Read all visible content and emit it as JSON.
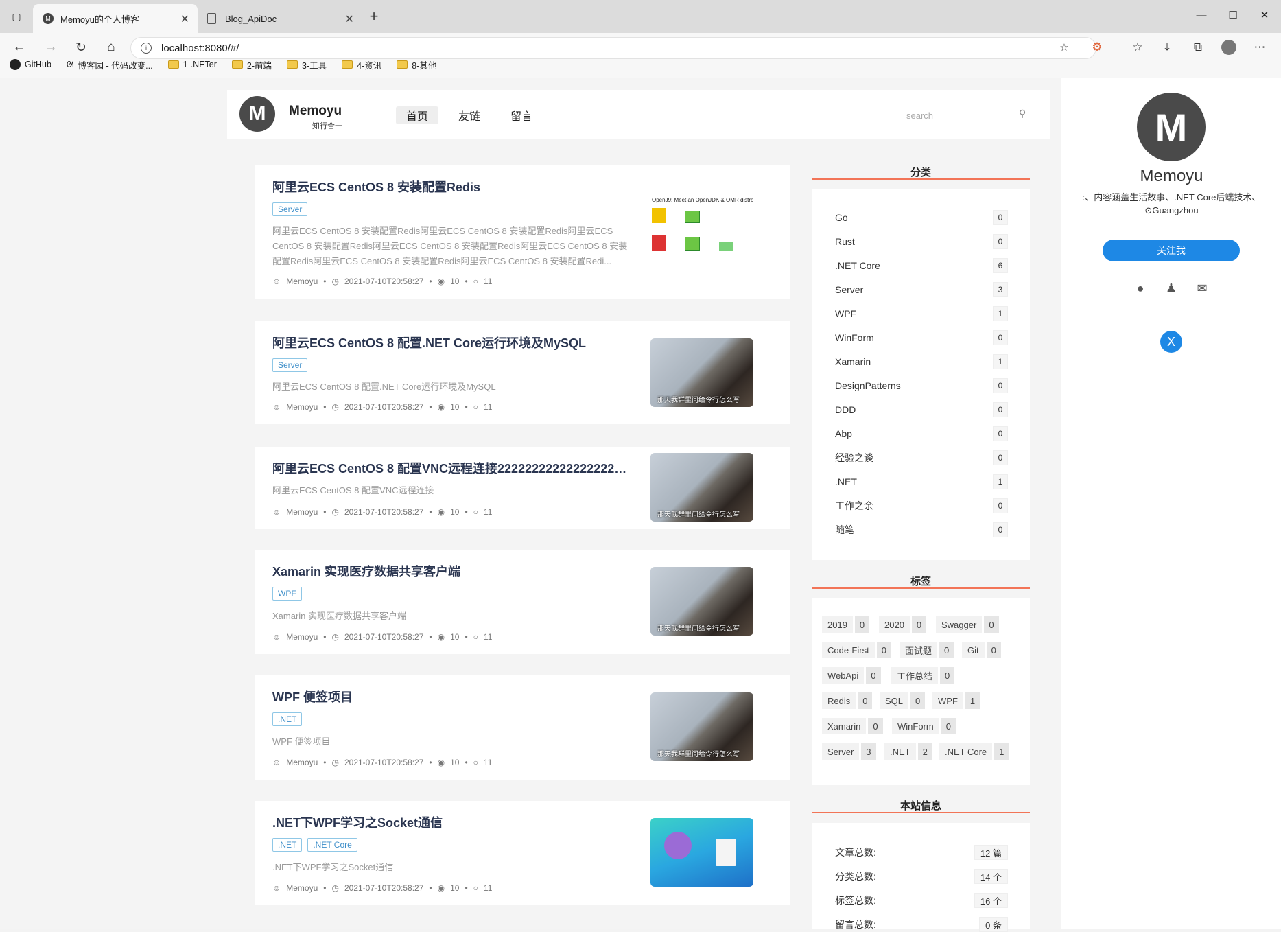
{
  "browser": {
    "tabs": [
      {
        "title": "Memoyu的个人博客",
        "active": true
      },
      {
        "title": "Blog_ApiDoc",
        "active": false
      }
    ],
    "url": "localhost:8080/#/",
    "bookmarks": [
      "GitHub",
      "博客园 - 代码改变...",
      "1-.NETer",
      "2-前端",
      "3-工具",
      "4-资讯",
      "8-其他"
    ]
  },
  "header": {
    "brand": "Memoyu",
    "subtitle": "知行合一",
    "nav": [
      "首页",
      "友链",
      "留言"
    ],
    "search_placeholder": "search"
  },
  "articles": [
    {
      "title": "阿里云ECS CentOS 8 安装配置Redis",
      "tags": [
        "Server"
      ],
      "summary": "阿里云ECS CentOS 8 安装配置Redis阿里云ECS CentOS 8 安装配置Redis阿里云ECS CentOS 8 安装配置Redis阿里云ECS CentOS 8 安装配置Redis阿里云ECS CentOS 8 安装配置Redis阿里云ECS CentOS 8 安装配置Redis阿里云ECS CentOS 8 安装配置Redi...",
      "author": "Memoyu",
      "date": "2021-07-10T20:58:27",
      "views": "10",
      "comments": "11"
    },
    {
      "title": "阿里云ECS CentOS 8 配置.NET Core运行环境及MySQL",
      "tags": [
        "Server"
      ],
      "summary": "阿里云ECS CentOS 8 配置.NET Core运行环境及MySQL",
      "author": "Memoyu",
      "date": "2021-07-10T20:58:27",
      "views": "10",
      "comments": "11",
      "caption": "那天我群里问给令行怎么写"
    },
    {
      "title": "阿里云ECS CentOS 8 配置VNC远程连接2222222222222222222...",
      "tags": [],
      "summary": "阿里云ECS CentOS 8 配置VNC远程连接",
      "author": "Memoyu",
      "date": "2021-07-10T20:58:27",
      "views": "10",
      "comments": "11",
      "caption": "那天我群里问给令行怎么写"
    },
    {
      "title": "Xamarin 实现医疗数据共享客户端",
      "tags": [
        "WPF"
      ],
      "summary": "Xamarin 实现医疗数据共享客户端",
      "author": "Memoyu",
      "date": "2021-07-10T20:58:27",
      "views": "10",
      "comments": "11",
      "caption": "那天我群里问给令行怎么写"
    },
    {
      "title": "WPF 便签项目",
      "tags": [
        ".NET"
      ],
      "summary": "WPF 便签项目",
      "author": "Memoyu",
      "date": "2021-07-10T20:58:27",
      "views": "10",
      "comments": "11",
      "caption": "那天我群里问给令行怎么写"
    },
    {
      "title": ".NET下WPF学习之Socket通信",
      "tags": [
        ".NET",
        ".NET Core"
      ],
      "summary": ".NET下WPF学习之Socket通信",
      "author": "Memoyu",
      "date": "2021-07-10T20:58:27",
      "views": "10",
      "comments": "11"
    }
  ],
  "diagram_thumb": {
    "title": "OpenJ9: Meet an OpenJDK & OMR distro"
  },
  "categories": {
    "title": "分类",
    "items": [
      {
        "name": "Go",
        "count": "0"
      },
      {
        "name": "Rust",
        "count": "0"
      },
      {
        "name": ".NET Core",
        "count": "6"
      },
      {
        "name": "Server",
        "count": "3"
      },
      {
        "name": "WPF",
        "count": "1"
      },
      {
        "name": "WinForm",
        "count": "0"
      },
      {
        "name": "Xamarin",
        "count": "1"
      },
      {
        "name": "DesignPatterns",
        "count": "0"
      },
      {
        "name": "DDD",
        "count": "0"
      },
      {
        "name": "Abp",
        "count": "0"
      },
      {
        "name": "经验之谈",
        "count": "0"
      },
      {
        "name": ".NET",
        "count": "1"
      },
      {
        "name": "工作之余",
        "count": "0"
      },
      {
        "name": "随笔",
        "count": "0"
      }
    ]
  },
  "tags_widget": {
    "title": "标签",
    "items": [
      {
        "name": "2019",
        "count": "0"
      },
      {
        "name": "2020",
        "count": "0"
      },
      {
        "name": "Swagger",
        "count": "0"
      },
      {
        "name": "Code-First",
        "count": "0"
      },
      {
        "name": "面试题",
        "count": "0"
      },
      {
        "name": "Git",
        "count": "0"
      },
      {
        "name": "WebApi",
        "count": "0"
      },
      {
        "name": "工作总结",
        "count": "0"
      },
      {
        "name": "Redis",
        "count": "0"
      },
      {
        "name": "SQL",
        "count": "0"
      },
      {
        "name": "WPF",
        "count": "1"
      },
      {
        "name": "Xamarin",
        "count": "0"
      },
      {
        "name": "WinForm",
        "count": "0"
      },
      {
        "name": "Server",
        "count": "3"
      },
      {
        "name": ".NET",
        "count": "2"
      },
      {
        "name": ".NET Core",
        "count": "1"
      }
    ]
  },
  "site_info": {
    "title": "本站信息",
    "rows": [
      {
        "label": "文章总数:",
        "value": "12 篇"
      },
      {
        "label": "分类总数:",
        "value": "14 个"
      },
      {
        "label": "标签总数:",
        "value": "16 个"
      },
      {
        "label": "留言总数:",
        "value": "0 条"
      }
    ]
  },
  "profile": {
    "name": "Memoyu",
    "bio": ":、内容涵盖生活故事、.NET Core后端技术、",
    "location": "Guangzhou",
    "follow_label": "关注我",
    "close_label": "X"
  },
  "colors": {
    "accent": "#1e88e5",
    "widget_underline": "#f27457",
    "tag_border": "#8fc7e6"
  }
}
